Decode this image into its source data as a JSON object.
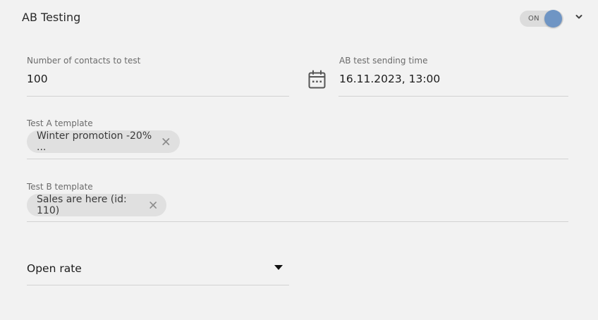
{
  "section": {
    "title": "AB Testing"
  },
  "toggle": {
    "label": "ON",
    "state": "on",
    "accent_color": "#6f95c4"
  },
  "fields": {
    "contacts": {
      "label": "Number of contacts to test",
      "value": "100"
    },
    "sending_time": {
      "label": "AB test sending time",
      "value": "16.11.2023, 13:00"
    },
    "test_a": {
      "label": "Test A template",
      "chip": "Winter promotion -20% ..."
    },
    "test_b": {
      "label": "Test B template",
      "chip": "Sales are here (id: 110)"
    },
    "metric": {
      "value": "Open rate"
    }
  },
  "icons": {
    "chevron": "chevron-down-icon",
    "calendar": "calendar-icon",
    "chip_remove": "close-icon",
    "dropdown": "caret-down-icon"
  }
}
